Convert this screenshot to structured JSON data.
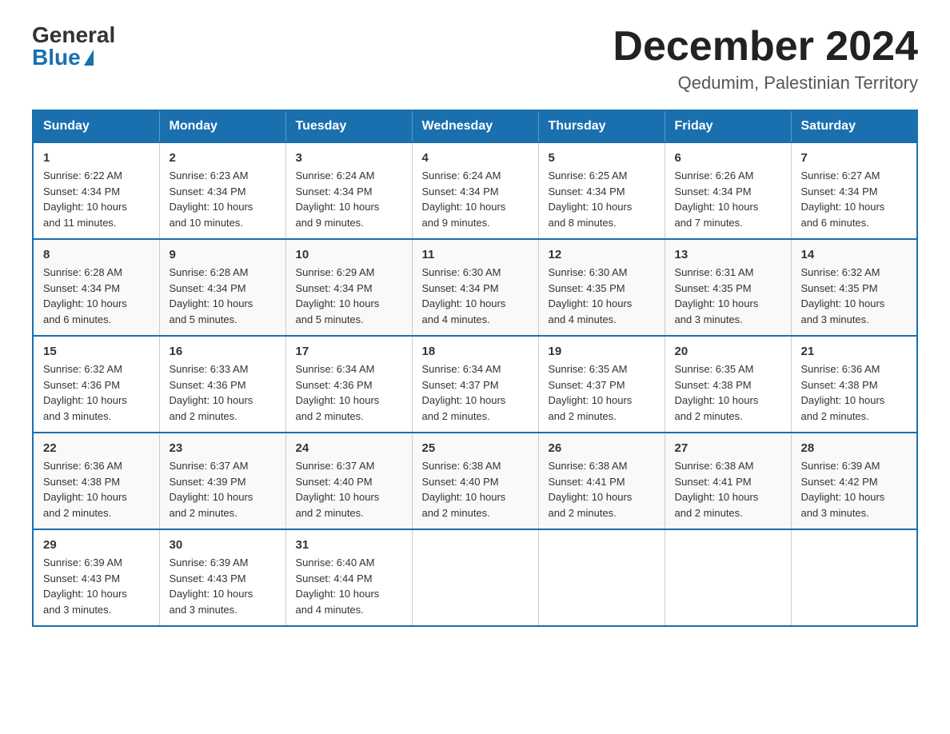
{
  "logo": {
    "general": "General",
    "blue": "Blue"
  },
  "title": "December 2024",
  "subtitle": "Qedumim, Palestinian Territory",
  "days_of_week": [
    "Sunday",
    "Monday",
    "Tuesday",
    "Wednesday",
    "Thursday",
    "Friday",
    "Saturday"
  ],
  "weeks": [
    [
      {
        "day": "1",
        "info": "Sunrise: 6:22 AM\nSunset: 4:34 PM\nDaylight: 10 hours\nand 11 minutes."
      },
      {
        "day": "2",
        "info": "Sunrise: 6:23 AM\nSunset: 4:34 PM\nDaylight: 10 hours\nand 10 minutes."
      },
      {
        "day": "3",
        "info": "Sunrise: 6:24 AM\nSunset: 4:34 PM\nDaylight: 10 hours\nand 9 minutes."
      },
      {
        "day": "4",
        "info": "Sunrise: 6:24 AM\nSunset: 4:34 PM\nDaylight: 10 hours\nand 9 minutes."
      },
      {
        "day": "5",
        "info": "Sunrise: 6:25 AM\nSunset: 4:34 PM\nDaylight: 10 hours\nand 8 minutes."
      },
      {
        "day": "6",
        "info": "Sunrise: 6:26 AM\nSunset: 4:34 PM\nDaylight: 10 hours\nand 7 minutes."
      },
      {
        "day": "7",
        "info": "Sunrise: 6:27 AM\nSunset: 4:34 PM\nDaylight: 10 hours\nand 6 minutes."
      }
    ],
    [
      {
        "day": "8",
        "info": "Sunrise: 6:28 AM\nSunset: 4:34 PM\nDaylight: 10 hours\nand 6 minutes."
      },
      {
        "day": "9",
        "info": "Sunrise: 6:28 AM\nSunset: 4:34 PM\nDaylight: 10 hours\nand 5 minutes."
      },
      {
        "day": "10",
        "info": "Sunrise: 6:29 AM\nSunset: 4:34 PM\nDaylight: 10 hours\nand 5 minutes."
      },
      {
        "day": "11",
        "info": "Sunrise: 6:30 AM\nSunset: 4:34 PM\nDaylight: 10 hours\nand 4 minutes."
      },
      {
        "day": "12",
        "info": "Sunrise: 6:30 AM\nSunset: 4:35 PM\nDaylight: 10 hours\nand 4 minutes."
      },
      {
        "day": "13",
        "info": "Sunrise: 6:31 AM\nSunset: 4:35 PM\nDaylight: 10 hours\nand 3 minutes."
      },
      {
        "day": "14",
        "info": "Sunrise: 6:32 AM\nSunset: 4:35 PM\nDaylight: 10 hours\nand 3 minutes."
      }
    ],
    [
      {
        "day": "15",
        "info": "Sunrise: 6:32 AM\nSunset: 4:36 PM\nDaylight: 10 hours\nand 3 minutes."
      },
      {
        "day": "16",
        "info": "Sunrise: 6:33 AM\nSunset: 4:36 PM\nDaylight: 10 hours\nand 2 minutes."
      },
      {
        "day": "17",
        "info": "Sunrise: 6:34 AM\nSunset: 4:36 PM\nDaylight: 10 hours\nand 2 minutes."
      },
      {
        "day": "18",
        "info": "Sunrise: 6:34 AM\nSunset: 4:37 PM\nDaylight: 10 hours\nand 2 minutes."
      },
      {
        "day": "19",
        "info": "Sunrise: 6:35 AM\nSunset: 4:37 PM\nDaylight: 10 hours\nand 2 minutes."
      },
      {
        "day": "20",
        "info": "Sunrise: 6:35 AM\nSunset: 4:38 PM\nDaylight: 10 hours\nand 2 minutes."
      },
      {
        "day": "21",
        "info": "Sunrise: 6:36 AM\nSunset: 4:38 PM\nDaylight: 10 hours\nand 2 minutes."
      }
    ],
    [
      {
        "day": "22",
        "info": "Sunrise: 6:36 AM\nSunset: 4:38 PM\nDaylight: 10 hours\nand 2 minutes."
      },
      {
        "day": "23",
        "info": "Sunrise: 6:37 AM\nSunset: 4:39 PM\nDaylight: 10 hours\nand 2 minutes."
      },
      {
        "day": "24",
        "info": "Sunrise: 6:37 AM\nSunset: 4:40 PM\nDaylight: 10 hours\nand 2 minutes."
      },
      {
        "day": "25",
        "info": "Sunrise: 6:38 AM\nSunset: 4:40 PM\nDaylight: 10 hours\nand 2 minutes."
      },
      {
        "day": "26",
        "info": "Sunrise: 6:38 AM\nSunset: 4:41 PM\nDaylight: 10 hours\nand 2 minutes."
      },
      {
        "day": "27",
        "info": "Sunrise: 6:38 AM\nSunset: 4:41 PM\nDaylight: 10 hours\nand 2 minutes."
      },
      {
        "day": "28",
        "info": "Sunrise: 6:39 AM\nSunset: 4:42 PM\nDaylight: 10 hours\nand 3 minutes."
      }
    ],
    [
      {
        "day": "29",
        "info": "Sunrise: 6:39 AM\nSunset: 4:43 PM\nDaylight: 10 hours\nand 3 minutes."
      },
      {
        "day": "30",
        "info": "Sunrise: 6:39 AM\nSunset: 4:43 PM\nDaylight: 10 hours\nand 3 minutes."
      },
      {
        "day": "31",
        "info": "Sunrise: 6:40 AM\nSunset: 4:44 PM\nDaylight: 10 hours\nand 4 minutes."
      },
      {
        "day": "",
        "info": ""
      },
      {
        "day": "",
        "info": ""
      },
      {
        "day": "",
        "info": ""
      },
      {
        "day": "",
        "info": ""
      }
    ]
  ]
}
